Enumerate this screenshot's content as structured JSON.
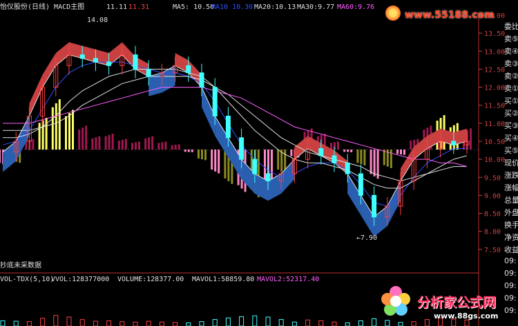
{
  "header": {
    "title": "怡仪股份(日线) MACD主图",
    "price_left": "11.11",
    "price_right": "11.31",
    "ma5": "MA5: 10.50",
    "ma10": "MA10 10.30",
    "ma20": "MA20:10.13",
    "ma30": "MA30:9.77",
    "ma60": "MA60:9.76"
  },
  "watermark_url": "www.55188.com",
  "annotations": {
    "high": "14.08",
    "low": "←7.90",
    "note": "抄底未采数据"
  },
  "volume_header": {
    "name": "VOL-TDX(5,10)",
    "vvol": "VVOL:128377000",
    "volume": "VOLUME:128377.00",
    "mavol1": "MAVOL1:58859.80",
    "mavol2": "MAVOL2:52317.40"
  },
  "side_labels": [
    "委比",
    "卖⑤",
    "卖④",
    "卖③",
    "卖②",
    "卖①",
    "买①",
    "买②",
    "买③",
    "买④",
    "买⑤",
    "现价",
    "涨跌",
    "涨幅",
    "总量",
    "外盘",
    "换手",
    "净资",
    "收益",
    "09:",
    "09:",
    "09:",
    "09:",
    "09:"
  ],
  "brand": {
    "name": "分析家公式网",
    "url": "www.88gs.com"
  },
  "colors": {
    "background": "#000000",
    "axis_text": "#d04040",
    "header_text": "#e0e0e0",
    "ma5": "#e0e0e0",
    "ma10": "#3050ff",
    "ma20": "#e0e0e0",
    "ma30": "#e0e0e0",
    "ma60": "#ff60ff",
    "up_band": "#c84040",
    "down_band": "#2a5fb0",
    "hist_pos_bright": "#ffff66",
    "hist_pos_dark": "#a01850",
    "hist_neg_pink": "#ff88c8",
    "hist_neg_olive": "#8a8a20",
    "candle_up": "#ff4040",
    "candle_down": "#40ffff"
  },
  "chart_data": {
    "type": "line",
    "title": "怡仪股份(日线) MACD主图",
    "ylim": [
      7.0,
      14.0
    ],
    "y_ticks": [
      7.5,
      8.0,
      8.5,
      9.0,
      9.5,
      10.0,
      10.5,
      11.0,
      11.5,
      12.0,
      12.5,
      13.0,
      13.5,
      14.0
    ],
    "series": [
      {
        "name": "MA5",
        "values": [
          10.2,
          10.5,
          11.2,
          12.0,
          12.6,
          12.9,
          12.8,
          12.7,
          12.6,
          12.9,
          12.5,
          12.3,
          12.4,
          12.6,
          12.4,
          12.0,
          11.2,
          10.6,
          10.0,
          9.6,
          9.4,
          9.6,
          10.0,
          10.3,
          10.1,
          9.9,
          9.6,
          9.0,
          8.4,
          8.7,
          9.4,
          10.0,
          10.3,
          10.5,
          10.4,
          10.5
        ]
      },
      {
        "name": "MA10",
        "values": [
          10.4,
          10.5,
          10.8,
          11.4,
          12.0,
          12.4,
          12.6,
          12.7,
          12.7,
          12.7,
          12.6,
          12.5,
          12.4,
          12.4,
          12.3,
          12.1,
          11.6,
          11.0,
          10.4,
          10.0,
          9.7,
          9.5,
          9.6,
          9.8,
          9.9,
          9.9,
          9.7,
          9.3,
          8.8,
          8.7,
          9.0,
          9.5,
          9.9,
          10.1,
          10.3,
          10.3
        ]
      },
      {
        "name": "MA20",
        "values": [
          10.6,
          10.6,
          10.7,
          10.9,
          11.2,
          11.6,
          11.9,
          12.1,
          12.3,
          12.4,
          12.5,
          12.5,
          12.5,
          12.5,
          12.4,
          12.3,
          12.0,
          11.6,
          11.2,
          10.8,
          10.5,
          10.2,
          10.0,
          9.9,
          9.9,
          9.8,
          9.7,
          9.5,
          9.3,
          9.2,
          9.2,
          9.4,
          9.6,
          9.8,
          10.0,
          10.1
        ]
      },
      {
        "name": "MA30",
        "values": [
          10.8,
          10.8,
          10.8,
          10.9,
          11.0,
          11.2,
          11.5,
          11.7,
          11.9,
          12.1,
          12.2,
          12.3,
          12.3,
          12.3,
          12.3,
          12.2,
          12.0,
          11.8,
          11.5,
          11.2,
          10.9,
          10.6,
          10.4,
          10.2,
          10.1,
          10.0,
          9.9,
          9.8,
          9.6,
          9.5,
          9.4,
          9.5,
          9.6,
          9.7,
          9.8,
          9.8
        ]
      },
      {
        "name": "MA60",
        "values": [
          11.0,
          11.0,
          11.0,
          11.1,
          11.2,
          11.3,
          11.4,
          11.5,
          11.6,
          11.7,
          11.8,
          11.9,
          12.0,
          12.0,
          12.0,
          12.0,
          11.9,
          11.8,
          11.7,
          11.5,
          11.3,
          11.1,
          10.9,
          10.8,
          10.7,
          10.6,
          10.5,
          10.4,
          10.3,
          10.2,
          10.1,
          10.0,
          10.0,
          9.9,
          9.9,
          9.8
        ]
      }
    ],
    "macd_hist": [
      -0.6,
      -0.5,
      0.4,
      1.2,
      1.9,
      1.5,
      0.9,
      0.5,
      0.6,
      0.4,
      0.3,
      0.5,
      0.3,
      0.2,
      -0.1,
      -0.4,
      -0.9,
      -1.3,
      -1.6,
      -1.8,
      -1.5,
      -0.9,
      -0.3,
      0.8,
      0.6,
      0.3,
      -0.1,
      -0.6,
      -1.1,
      -0.7,
      -0.2,
      0.4,
      0.9,
      1.3,
      1.0,
      0.8
    ]
  }
}
